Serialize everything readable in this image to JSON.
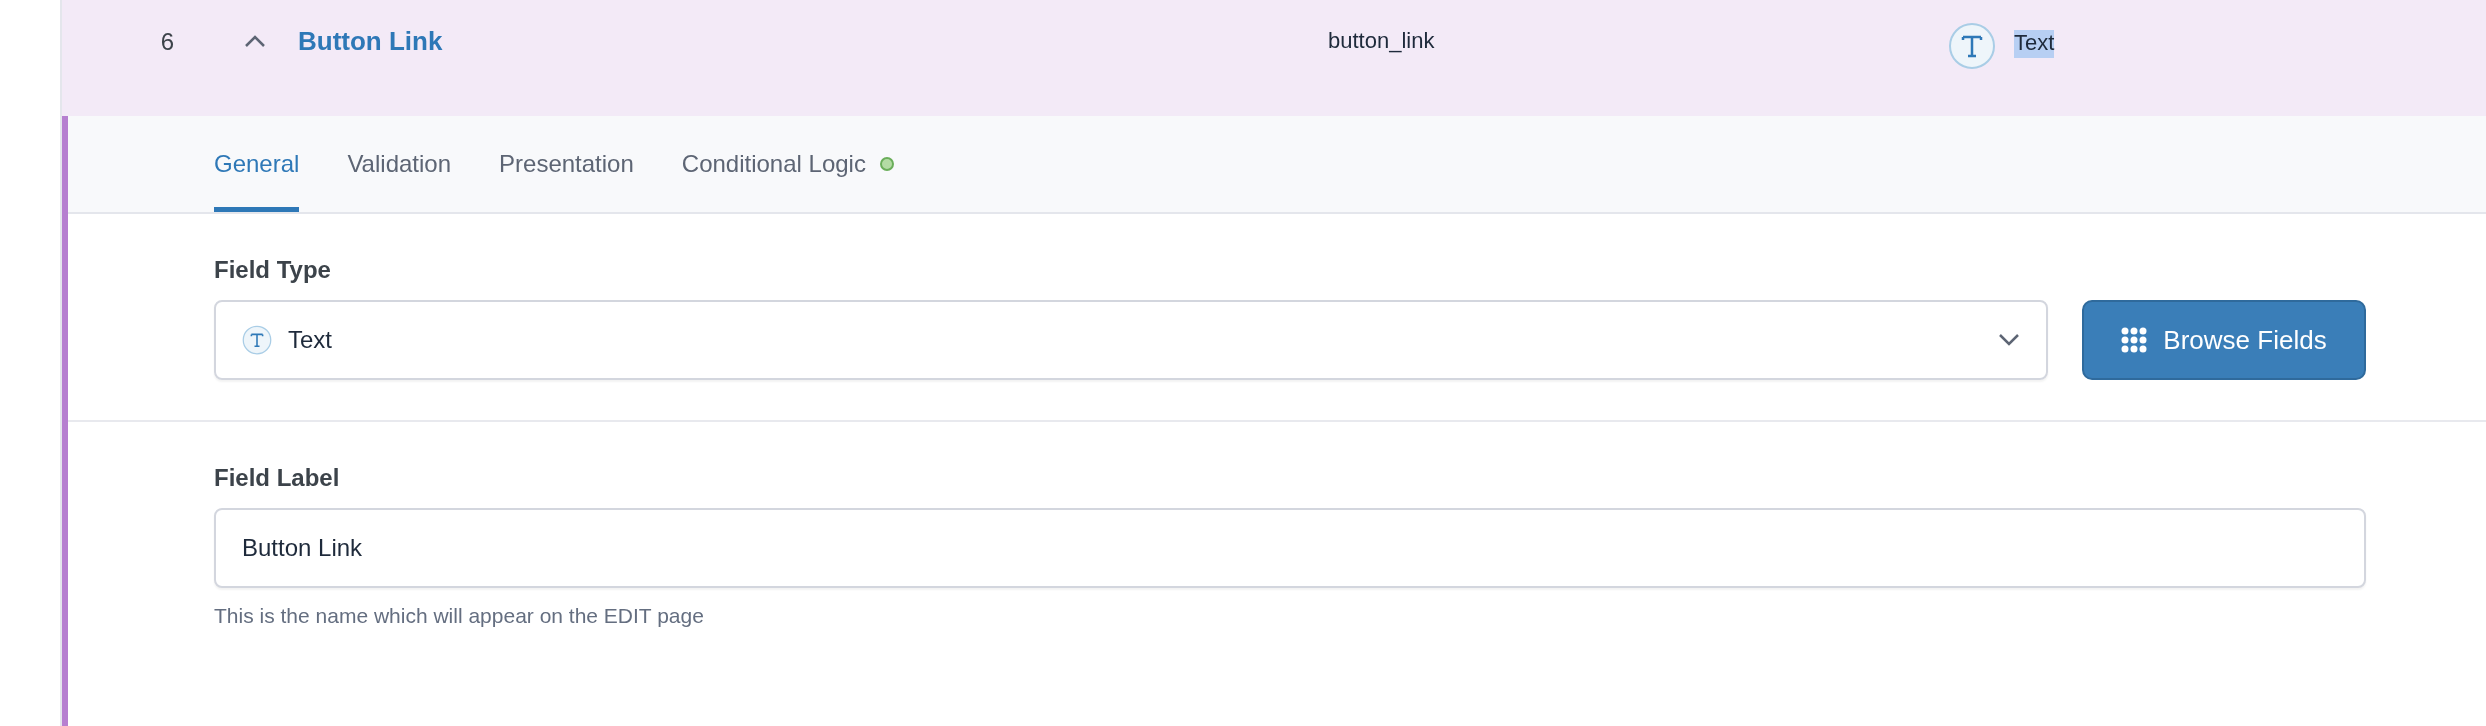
{
  "field_row": {
    "number": "6",
    "expanded": true,
    "title": "Button Link",
    "key": "button_link",
    "type_label": "Text",
    "type_label_highlighted": true
  },
  "tabs": [
    {
      "label": "General",
      "selected": true,
      "indicator": false
    },
    {
      "label": "Validation",
      "selected": false,
      "indicator": false
    },
    {
      "label": "Presentation",
      "selected": false,
      "indicator": false
    },
    {
      "label": "Conditional Logic",
      "selected": false,
      "indicator": true
    }
  ],
  "field_type": {
    "label": "Field Type",
    "value": "Text",
    "button": "Browse Fields"
  },
  "field_label": {
    "label": "Field Label",
    "value": "Button Link",
    "help": "This is the name which will appear on the EDIT page"
  }
}
